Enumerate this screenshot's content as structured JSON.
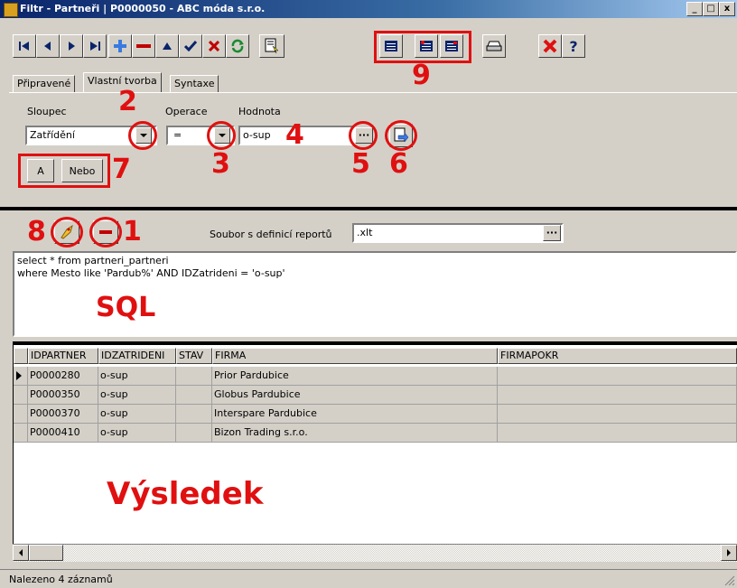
{
  "window": {
    "title": "Filtr - Partneři | P0000050 - ABC móda s.r.o.",
    "min": "_",
    "max": "□",
    "close": "x"
  },
  "tabs": [
    "Připravené",
    "Vlastní tvorba",
    "Syntaxe"
  ],
  "form": {
    "col_label": "Sloupec",
    "op_label": "Operace",
    "val_label": "Hodnota",
    "col_value": "Zatřídění",
    "op_value": "=",
    "val_value": "o-sup",
    "and_btn": "A",
    "or_btn": "Nebo"
  },
  "report": {
    "label": "Soubor s definicí reportů",
    "value": ".xlt",
    "browse": "..."
  },
  "sql_text": [
    "select * from partneri_partneri",
    "where Mesto like 'Pardub%' AND IDZatrideni = 'o-sup'"
  ],
  "grid": {
    "headers": [
      "IDPARTNER",
      "IDZATRIDENI",
      "STAV",
      "FIRMA",
      "FIRMAPOKR"
    ],
    "rows": [
      [
        "P0000280",
        "o-sup",
        "",
        "Prior Pardubice",
        ""
      ],
      [
        "P0000350",
        "o-sup",
        "",
        "Globus Pardubice",
        ""
      ],
      [
        "P0000370",
        "o-sup",
        "",
        "Interspare Pardubice",
        ""
      ],
      [
        "P0000410",
        "o-sup",
        "",
        "Bizon Trading s.r.o.",
        ""
      ]
    ]
  },
  "status": "Nalezeno 4 záznamů",
  "annotations": {
    "n1": "1",
    "n2": "2",
    "n3": "3",
    "n4": "4",
    "n5": "5",
    "n6": "6",
    "n7": "7",
    "n8": "8",
    "n9": "9",
    "sql": "SQL",
    "result": "Výsledek"
  },
  "colors": {
    "annotation": "#e01010",
    "title_start": "#0a246a",
    "title_end": "#a6caf0"
  }
}
